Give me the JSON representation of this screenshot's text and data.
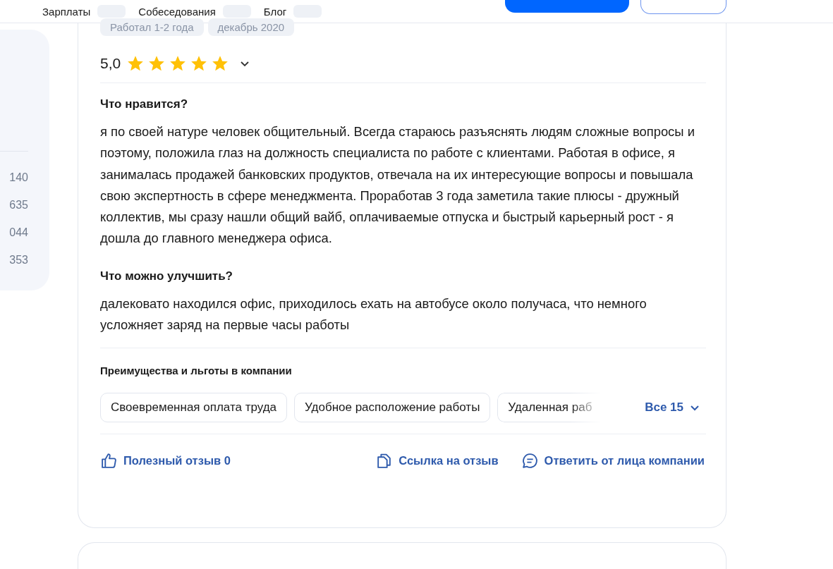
{
  "nav": [
    {
      "label": "Зарплаты"
    },
    {
      "label": "Собеседования"
    },
    {
      "label": "Блог"
    }
  ],
  "sidebar": {
    "counts": [
      "140",
      "635",
      "044",
      "353"
    ]
  },
  "review": {
    "tags": [
      "Работал 1-2 года",
      "декабрь 2020"
    ],
    "rating": "5,0",
    "stars": 5,
    "sections": [
      {
        "title": "Что нравится?",
        "text": "я по своей натуре человек общительный. Всегда стараюсь разъяснять людям сложные вопросы и поэтому, положила глаз на должность специалиста по работе с клиентами. Работая в офисе, я занималась продажей банковских продуктов, отвечала на их интересующие вопросы и повышала свою экспертность в сфере менеджмента. Проработав 3 года заметила такие плюсы - дружный коллектив, мы сразу нашли общий вайб, оплачиваемые отпуска и быстрый карьерный рост - я дошла до главного менеджера офиса."
      },
      {
        "title": "Что можно улучшить?",
        "text": "далековато находился офис, приходилось ехать на автобусе около получаса, что немного усложняет заряд на первые часы работы"
      }
    ],
    "benefits": {
      "title": "Преимущества и льготы в компании",
      "items": [
        "Своевременная оплата труда",
        "Удобное расположение работы",
        "Удаленная раб"
      ],
      "all": "Все 15"
    },
    "actions": [
      {
        "kind": "like",
        "label": "Полезный отзыв 0"
      },
      {
        "kind": "link",
        "label": "Ссылка на отзыв"
      },
      {
        "kind": "reply",
        "label": "Ответить от лица компании"
      }
    ]
  }
}
